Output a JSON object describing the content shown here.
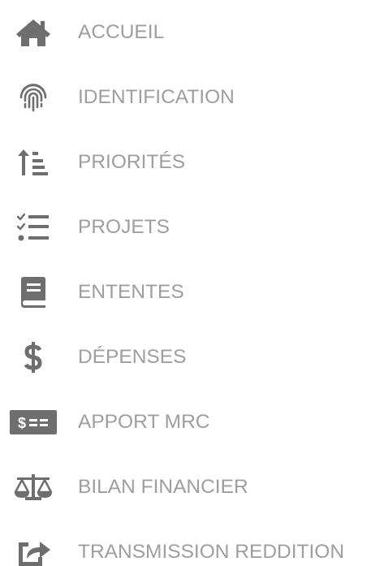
{
  "menu": {
    "items": [
      {
        "label": "ACCUEIL",
        "icon": "home-icon"
      },
      {
        "label": "IDENTIFICATION",
        "icon": "fingerprint-icon"
      },
      {
        "label": "PRIORITÉS",
        "icon": "sort-amount-up-icon"
      },
      {
        "label": "PROJETS",
        "icon": "checklist-icon"
      },
      {
        "label": "ENTENTES",
        "icon": "book-icon"
      },
      {
        "label": "DÉPENSES",
        "icon": "dollar-sign-icon"
      },
      {
        "label": "APPORT MRC",
        "icon": "money-bill-icon"
      },
      {
        "label": "BILAN FINANCIER",
        "icon": "balance-scale-icon"
      },
      {
        "label": "TRANSMISSION REDDITION",
        "icon": "share-square-icon"
      }
    ],
    "icon_color": "#6e6e6e",
    "text_color": "#9e9e9e"
  }
}
